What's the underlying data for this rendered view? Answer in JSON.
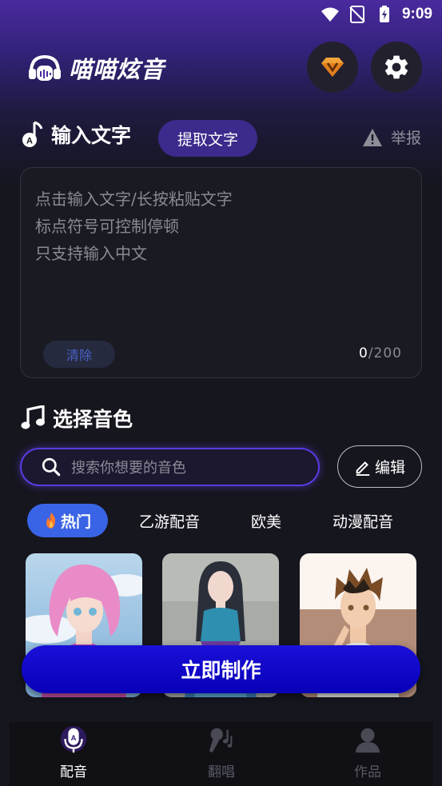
{
  "status_bar": {
    "time": "9:09"
  },
  "header": {
    "app_name": "喵喵炫音"
  },
  "input_section": {
    "title": "输入文字",
    "extract_label": "提取文字",
    "report_label": "举报",
    "placeholder_lines": [
      "点击输入文字/长按粘贴文字",
      "标点符号可控制停顿",
      "只支持输入中文"
    ],
    "clear_label": "清除",
    "count_current": "0",
    "count_max": "/200"
  },
  "voice_section": {
    "title": "选择音色",
    "search_placeholder": "搜索你想要的音色",
    "edit_label": "编辑",
    "tabs": [
      {
        "label": "热门",
        "active": true
      },
      {
        "label": "乙游配音",
        "active": false
      },
      {
        "label": "欧美",
        "active": false
      },
      {
        "label": "动漫配音",
        "active": false
      }
    ]
  },
  "make_button": {
    "label": "立即制作"
  },
  "bottom_nav": [
    {
      "label": "配音",
      "active": true
    },
    {
      "label": "翻唱",
      "active": false
    },
    {
      "label": "作品",
      "active": false
    }
  ],
  "colors": {
    "accent": "#3a64e6",
    "primary_button": "#0800b8",
    "extract_button": "#3c2a8c",
    "search_border": "#5b3ae0"
  }
}
